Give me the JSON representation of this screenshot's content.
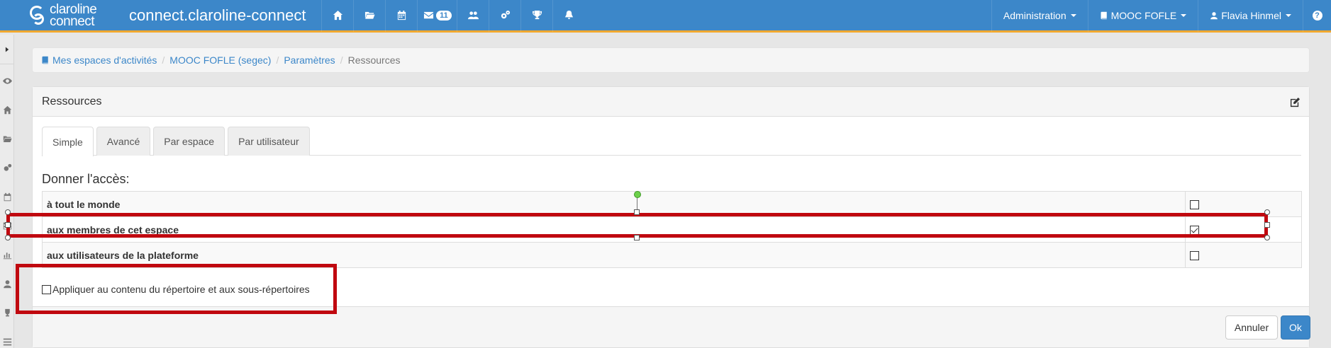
{
  "navbar": {
    "brand_line1": "claroline",
    "brand_line2": "connect",
    "site_title": "connect.claroline-connect",
    "icons": [
      "home-icon",
      "folder-icon",
      "calendar-icon",
      "envelope-icon",
      "users-icon",
      "cogs-icon",
      "trophy-icon",
      "bell-icon"
    ],
    "mail_count": "11",
    "admin_label": "Administration",
    "workspace_label": "MOOC FOFLE",
    "user_label": "Flavia Hinmel",
    "help_label": "?",
    "accent_color": "#3c87c9",
    "border_color": "#f0a830"
  },
  "sidebar": {
    "icons": [
      "chevron-right-icon",
      "eye-icon",
      "home-icon",
      "folder-open-icon",
      "cogs-icon",
      "calendar-icon",
      "table-icon",
      "bar-chart-icon",
      "user-icon",
      "trophy-icon",
      "list-icon"
    ]
  },
  "breadcrumb": {
    "items": [
      "Mes espaces d'activités",
      "MOOC FOFLE (segec)",
      "Paramètres"
    ],
    "active": "Ressources"
  },
  "panel": {
    "title": "Ressources",
    "tabs": [
      "Simple",
      "Avancé",
      "Par espace",
      "Par utilisateur"
    ],
    "active_tab": "Simple",
    "section_title": "Donner l'accès:",
    "rows": [
      {
        "label": "à tout le monde",
        "checked": false
      },
      {
        "label": "aux membres de cet espace",
        "checked": true
      },
      {
        "label": "aux utilisateurs de la plateforme",
        "checked": false
      }
    ],
    "apply_label": "Appliquer au contenu du répertoire et aux sous-répertoires",
    "apply_checked": false,
    "cancel_label": "Annuler",
    "ok_label": "Ok"
  },
  "annotation_color": "#c0080f"
}
